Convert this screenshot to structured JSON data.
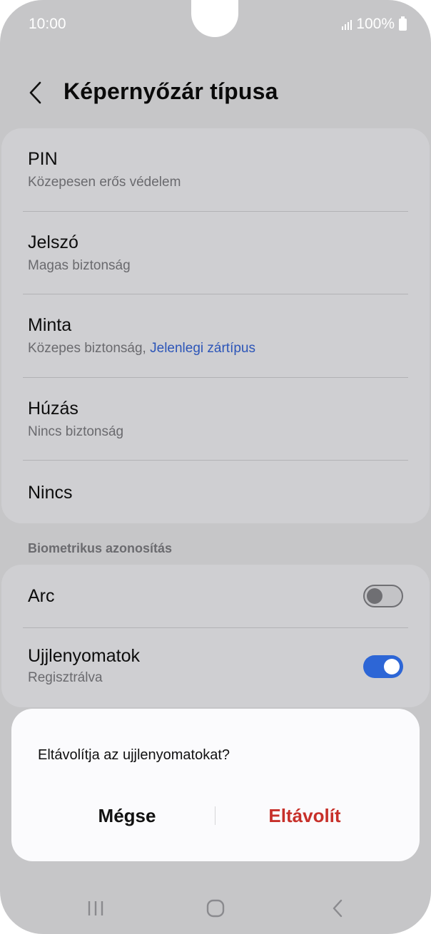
{
  "status_bar": {
    "time": "10:00",
    "battery": "100%",
    "signal_icon": "signal-bars-icon",
    "battery_icon": "battery-icon"
  },
  "header": {
    "back_icon": "chevron-left-icon",
    "title": "Képernyőzár típusa"
  },
  "lock_options": [
    {
      "title": "PIN",
      "subtitle": "Közepesen erős védelem"
    },
    {
      "title": "Jelszó",
      "subtitle": "Magas biztonság"
    },
    {
      "title": "Minta",
      "subtitle": "Közepes biztonság, ",
      "current_label": "Jelenlegi zártípus"
    },
    {
      "title": "Húzás",
      "subtitle": "Nincs biztonság"
    },
    {
      "title": "Nincs"
    }
  ],
  "biometrics": {
    "section_label": "Biometrikus azonosítás",
    "items": [
      {
        "title": "Arc",
        "enabled": false
      },
      {
        "title": "Ujjlenyomatok",
        "subtitle": "Regisztrálva",
        "enabled": true
      }
    ]
  },
  "dialog": {
    "message": "Eltávolítja az ujjlenyomatokat?",
    "cancel_label": "Mégse",
    "remove_label": "Eltávolít"
  },
  "navbar": {
    "recents_icon": "recents-icon",
    "home_icon": "home-icon",
    "back_icon": "back-chevron-icon"
  },
  "colors": {
    "accent_blue": "#2d66d6",
    "current_label": "#2c55b8",
    "destructive": "#c7302a",
    "background": "#c6c6c8"
  }
}
